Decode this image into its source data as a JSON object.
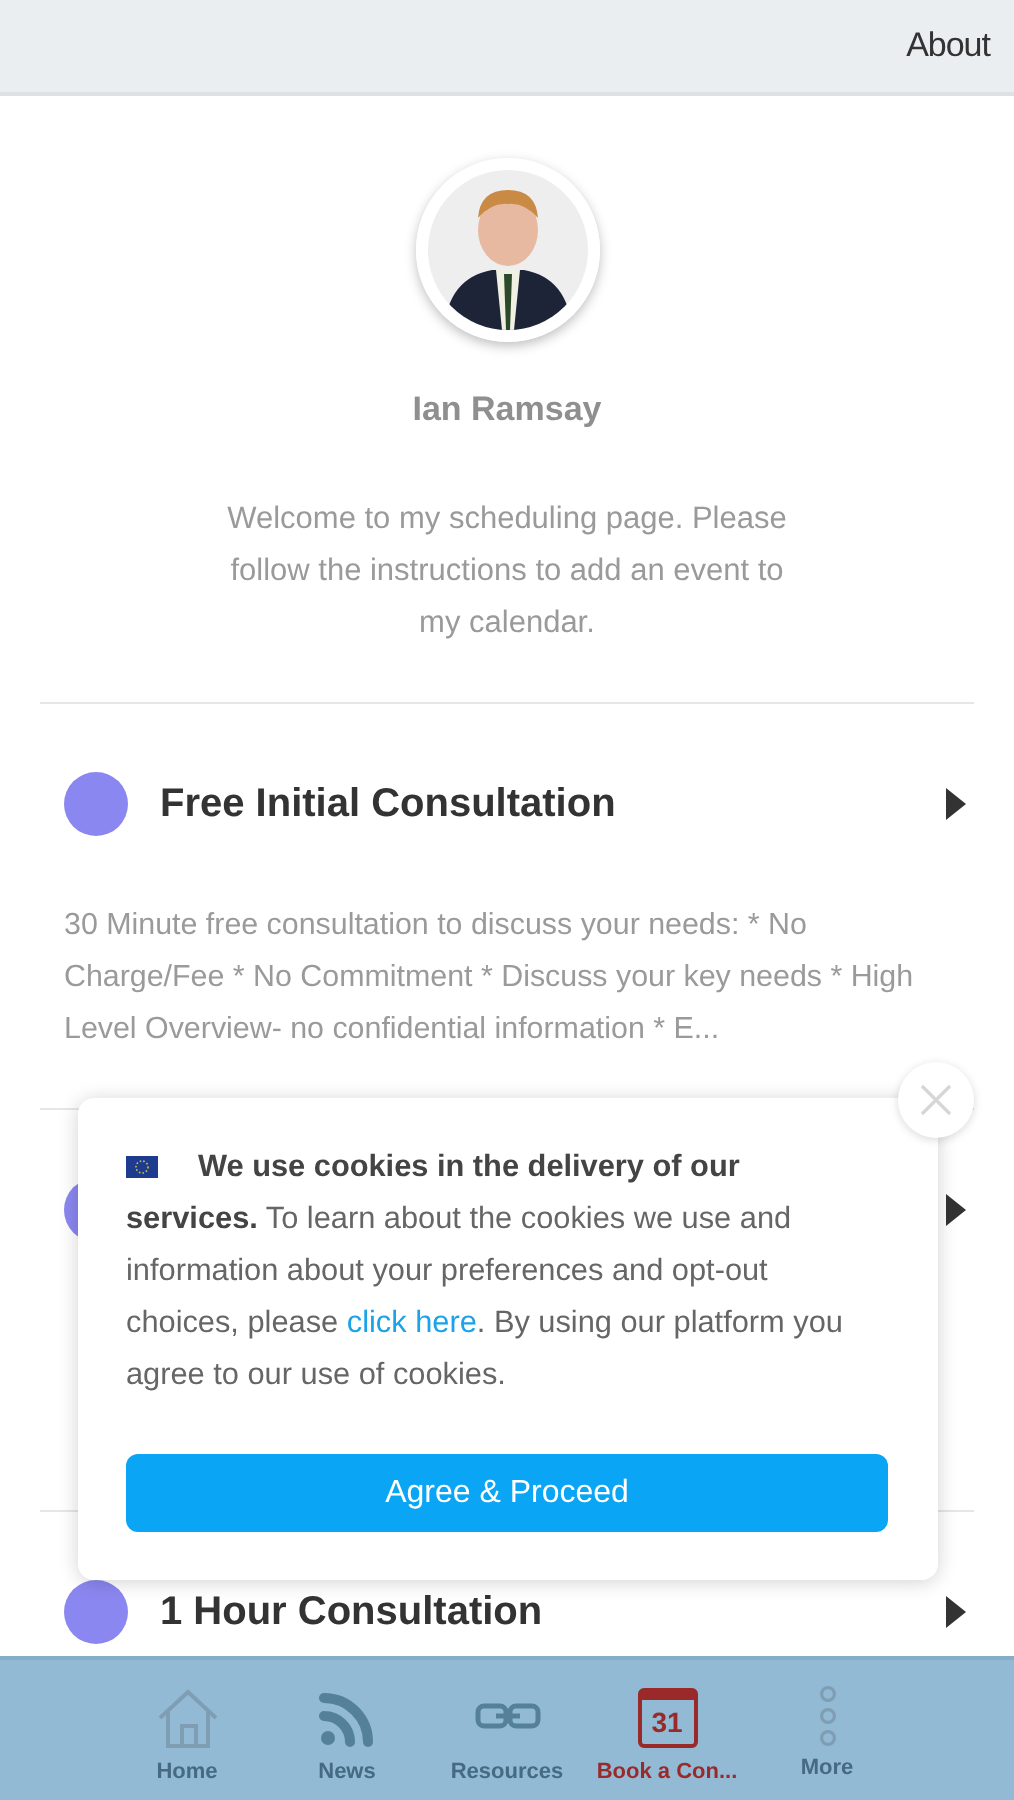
{
  "header": {
    "link": "About"
  },
  "profile": {
    "name": "Ian Ramsay",
    "welcome": "Welcome to my scheduling page. Please follow the instructions to add an event to my calendar."
  },
  "events": [
    {
      "title": "Free Initial Consultation",
      "color": "#8b87f0",
      "description": "30 Minute free consultation to discuss your needs: * No Charge/Fee * No Commitment * Discuss your key needs * High Level Overview- no confidential information * E..."
    },
    {
      "color": "#8b87f0"
    },
    {
      "title": "1 Hour Consultation",
      "color": "#8b87f0"
    }
  ],
  "cookie_banner": {
    "message_before": "**We use cookies in the delivery of our services.** To learn about the cookies we use and information about your preferences and opt-out choices, please ",
    "link": "click here",
    "message_after": ". By using our platform you agree to our use of cookies.",
    "button": "Agree & Proceed"
  },
  "tab_bar": [
    {
      "kind": "home",
      "label": "Home",
      "selected": false
    },
    {
      "kind": "news",
      "label": "News",
      "selected": false
    },
    {
      "kind": "link",
      "label": "Resources",
      "selected": false
    },
    {
      "kind": "calendar",
      "label": "Book a Con...",
      "icon_text": "31",
      "selected": true
    },
    {
      "kind": "more",
      "label": "More",
      "selected": false
    }
  ]
}
